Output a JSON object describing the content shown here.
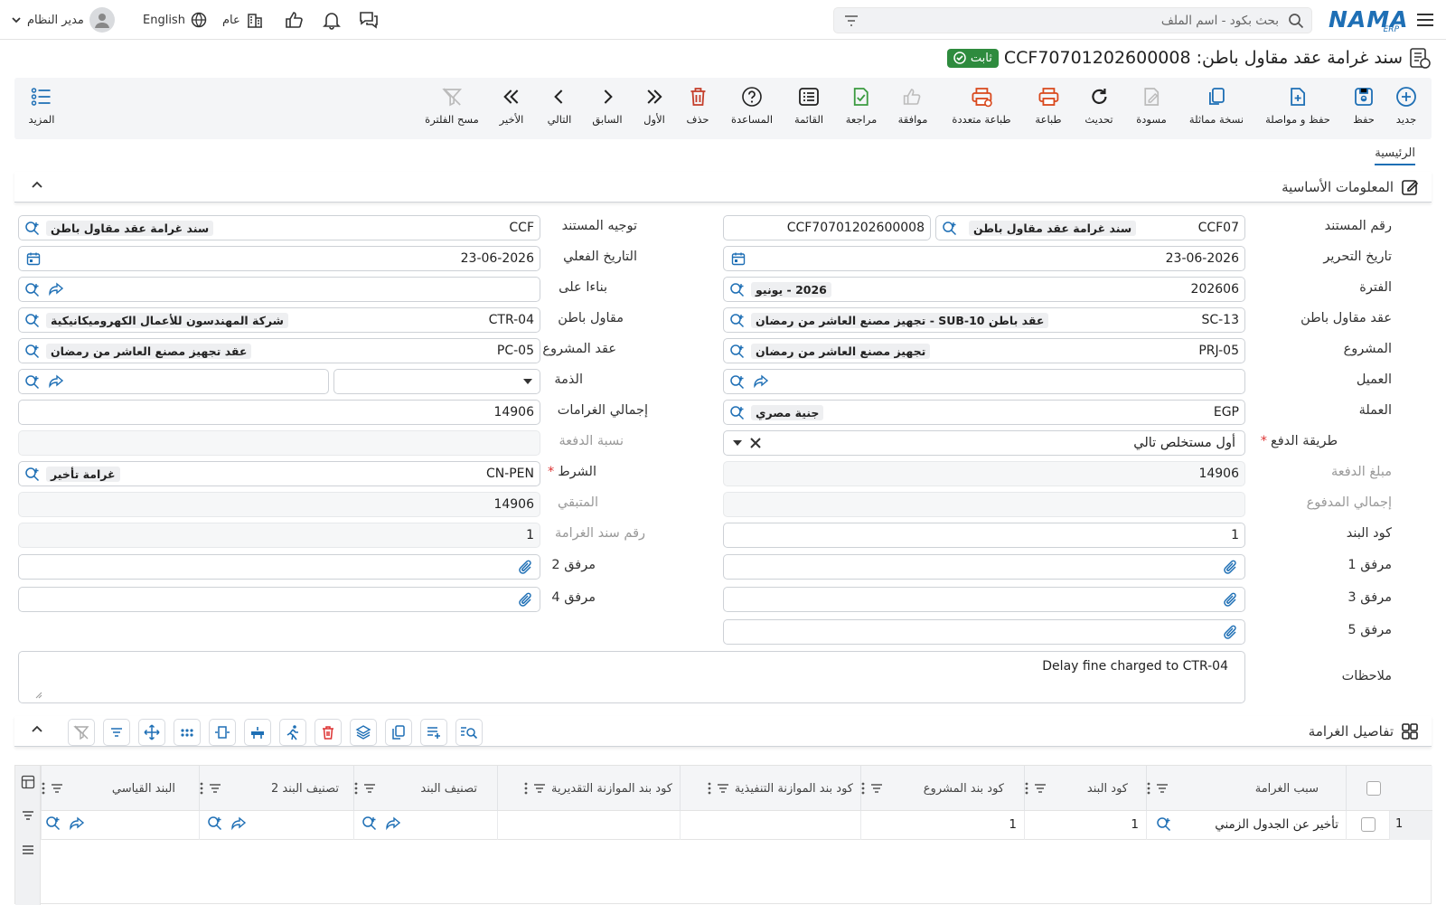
{
  "header": {
    "logo": "NAMA",
    "logo_sub": "ERP",
    "search_placeholder": "بحث بكود - اسم الملف",
    "user_name": "مدير النظام",
    "language": "English",
    "scope": "عام"
  },
  "document": {
    "title": "سند غرامة عقد مقاول باطن: CCF70701202600008",
    "status": "ثابت"
  },
  "toolbar": {
    "new": "جديد",
    "save": "حفظ",
    "save_continue": "حفظ و مواصلة",
    "duplicate": "نسخة مماثلة",
    "draft": "مسودة",
    "refresh": "تحديث",
    "print": "طباعة",
    "multi_print": "طباعة متعددة",
    "approve": "موافقة",
    "review": "مراجعة",
    "list": "القائمة",
    "help": "المساعدة",
    "delete": "حذف",
    "first": "الأول",
    "previous": "السابق",
    "next": "التالي",
    "last": "الأخير",
    "clear_filter": "مسح الفلترة",
    "more": "المزيد"
  },
  "tabs": {
    "main": "الرئيسية"
  },
  "sections": {
    "basic": "المعلومات الأساسية",
    "details": "تفاصيل الغرامة"
  },
  "form": {
    "doc_number": {
      "label": "رقم المستند",
      "code": "CCF07",
      "name": "سند غرامة عقد مقاول باطن",
      "number": "CCF70701202600008"
    },
    "doc_direction": {
      "label": "توجيه المستند",
      "code": "CCF",
      "name": "سند غرامة عقد مقاول باطن"
    },
    "issue_date": {
      "label": "تاريخ التحرير",
      "value": "23-06-2026"
    },
    "actual_date": {
      "label": "التاريخ الفعلي",
      "value": "23-06-2026"
    },
    "period": {
      "label": "الفترة",
      "code": "202606",
      "name": "2026 - يونيو"
    },
    "based_on": {
      "label": "بناءا على"
    },
    "subcontract": {
      "label": "عقد مقاول باطن",
      "code": "SC-13",
      "name": "عقد باطن SUB-10 - تجهيز مصنع العاشر من رمضان"
    },
    "subcontractor": {
      "label": "مقاول باطن",
      "code": "CTR-04",
      "name": "شركة المهندسون للأعمال الكهروميكانيكية"
    },
    "project": {
      "label": "المشروع",
      "code": "PRJ-05",
      "name": "تجهيز مصنع العاشر من رمضان"
    },
    "project_contract": {
      "label": "عقد المشروع",
      "code": "PC-05",
      "name": "عقد تجهيز مصنع العاشر من رمضان"
    },
    "customer": {
      "label": "العميل"
    },
    "liability": {
      "label": "الذمة"
    },
    "currency": {
      "label": "العملة",
      "code": "EGP",
      "name": "جنية مصري"
    },
    "total_fines": {
      "label": "إجمالي الغرامات",
      "value": "14906"
    },
    "payment_method": {
      "label": "طريقة الدفع",
      "value": "أول مستخلص تالي"
    },
    "payment_ratio": {
      "label": "نسبة الدفعة"
    },
    "payment_amount": {
      "label": "مبلغ الدفعة",
      "value": "14906"
    },
    "condition": {
      "label": "الشرط",
      "code": "CN-PEN",
      "name": "غرامة تأخير"
    },
    "total_paid": {
      "label": "إجمالي المدفوع"
    },
    "remaining": {
      "label": "المتبقي",
      "value": "14906"
    },
    "item_code": {
      "label": "كود البند",
      "value": "1"
    },
    "fine_doc_number": {
      "label": "رقم سند الغرامة",
      "value": "1"
    },
    "attachment1": {
      "label": "مرفق 1"
    },
    "attachment2": {
      "label": "مرفق 2"
    },
    "attachment3": {
      "label": "مرفق 3"
    },
    "attachment4": {
      "label": "مرفق 4"
    },
    "attachment5": {
      "label": "مرفق 5"
    },
    "notes": {
      "label": "ملاحظات",
      "value": "Delay fine charged to CTR-04"
    }
  },
  "grid": {
    "columns": [
      "سبب الغرامة",
      "كود البند",
      "كود بند المشروع",
      "كود بند الموازنة التنفيذية",
      "كود بند الموازنة التقديرية",
      "تصنيف البند",
      "تصنيف البند 2",
      "البند القياسي"
    ],
    "rows": [
      {
        "index": "1",
        "reason": "تأخير عن الجدول الزمني",
        "item_code": "1",
        "project_item_code": "1"
      }
    ]
  },
  "colors": {
    "brand": "#1e6fb5",
    "status_green": "#2e8b3e",
    "action_red": "#d9481c",
    "action_green": "#3a9a3f",
    "action_blue": "#1e6fb5"
  }
}
